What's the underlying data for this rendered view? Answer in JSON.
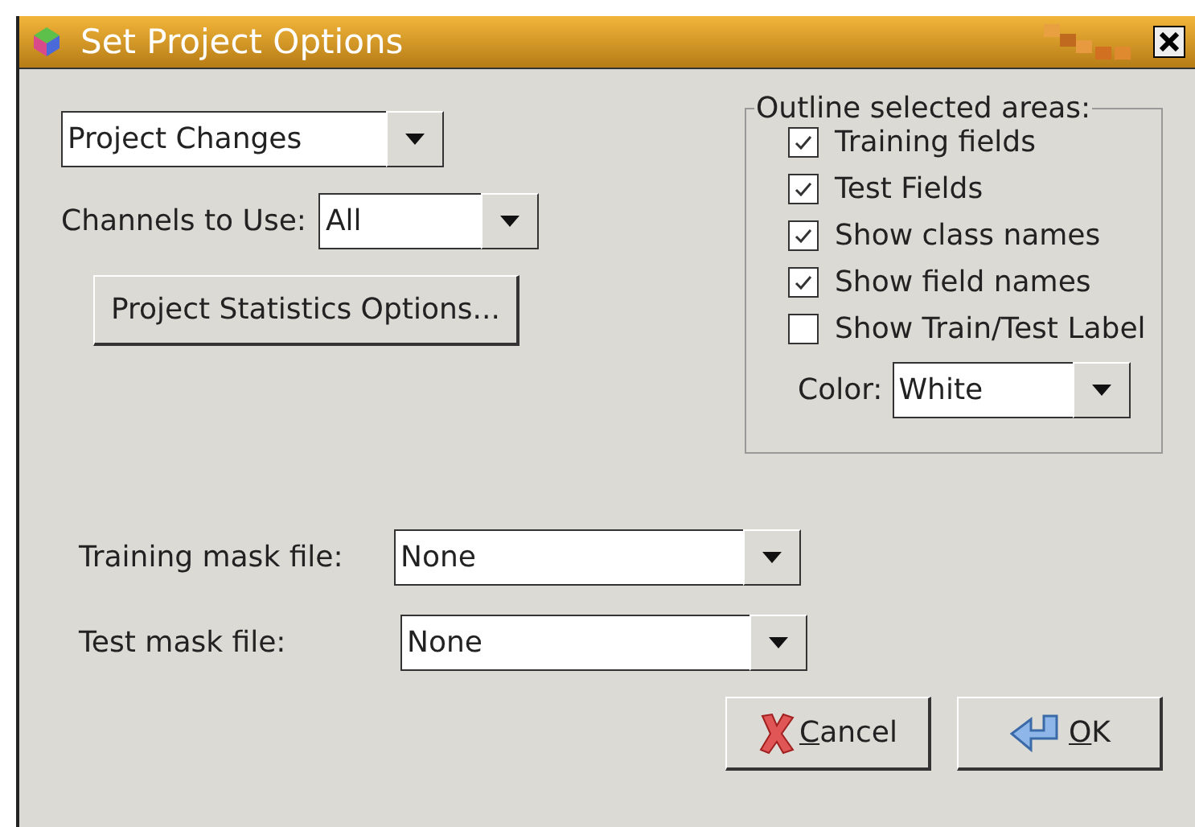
{
  "window": {
    "title": "Set Project Options"
  },
  "mode_select": {
    "value": "Project Changes"
  },
  "channels": {
    "label": "Channels to Use:",
    "value": "All"
  },
  "stats_button": {
    "label": "Project Statistics Options..."
  },
  "outline": {
    "legend": "Outline selected areas:",
    "options": [
      {
        "label": "Training fields",
        "checked": true
      },
      {
        "label": "Test Fields",
        "checked": true
      },
      {
        "label": "Show class names",
        "checked": true
      },
      {
        "label": "Show field names",
        "checked": true
      },
      {
        "label": "Show Train/Test Label",
        "checked": false
      }
    ],
    "color": {
      "label": "Color:",
      "value": "White"
    }
  },
  "training_mask": {
    "label": "Training mask file:",
    "value": "None"
  },
  "test_mask": {
    "label": "Test mask file:",
    "value": "None"
  },
  "buttons": [
    {
      "kind": "cancel",
      "label": "Cancel"
    },
    {
      "kind": "ok",
      "label": "OK"
    }
  ]
}
